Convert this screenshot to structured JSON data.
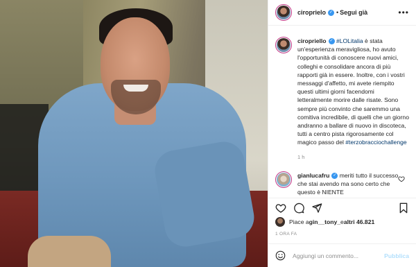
{
  "post": {
    "username": "ciroprielo",
    "follow_label": "Segui già",
    "caption_username": "ciropriello",
    "caption_hashtag_1": "#LOLitalia",
    "caption_text_1": " è stata un'esperienza meravigliosa, ho avuto l'opportunità di conoscere nuovi amici, colleghi e consolidare ancora di più rapporti già in essere. Inoltre, con i vostri messaggi d'affetto, mi avete riempito questi ultimi giorni facendomi letteralmente morire dalle risate. Sono sempre più convinto che saremmo una comitiva incredibile, di quelli che un giorno andranno a ballare di nuovo in discoteca, tutti a centro pista rigorosamente col magico passo del ",
    "caption_hashtag_2": "#terzobracciochallenge",
    "caption_age": "1 h",
    "comment_username": "gianlucafru",
    "comment_text": " meriti tutto il successo che stai avendo ma sono certo che questo è NIENTE",
    "likes_prefix": "Piace a ",
    "likes_user": "gin__tony_",
    "likes_middle": " e ",
    "likes_count": "altri 46.821",
    "time_ago": "1 ORA FA",
    "comment_placeholder": "Aggiungi un commento...",
    "publish_label": "Pubblica"
  },
  "icons": {
    "more": "more-options-icon",
    "like": "heart-icon",
    "comment": "comment-icon",
    "share": "share-icon",
    "save": "bookmark-icon",
    "emoji": "emoji-icon"
  },
  "colors": {
    "verified": "#3897f0",
    "hashtag": "#00376b",
    "muted": "#8e8e8e",
    "publish": "#b2dffc"
  }
}
